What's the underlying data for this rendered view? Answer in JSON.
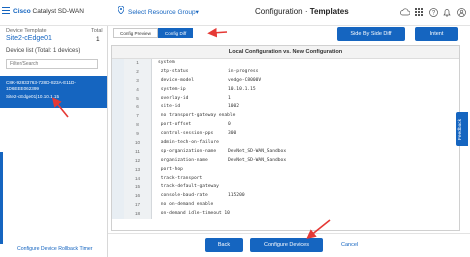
{
  "header": {
    "brand": "Cisco",
    "brand_product": "Catalyst SD-WAN",
    "resource_group": "Select Resource Group",
    "resource_chevron": "▾",
    "title_prefix": "Configuration",
    "title_separator": " · ",
    "title_main": "Templates",
    "icons": [
      "cloud-icon",
      "grid-icon",
      "help-icon",
      "bell-icon",
      "user-icon"
    ]
  },
  "sidebar": {
    "device_template_label": "Device Template",
    "device_template_value": "Site2-cEdge01",
    "total_label": "Total",
    "total_value": "1",
    "device_list_label": "Device list (Total: 1 devices)",
    "filter_placeholder": "Filter/Search",
    "device": {
      "id": "C8K-92833763-728D-823A-E11D-1D6EEE062399",
      "sub": "Site2-cEdge01|10.10.1.15"
    },
    "rollback_link": "Configure Device Rollback Timer"
  },
  "tabs": [
    {
      "label": "Config Preview",
      "active": false
    },
    {
      "label": "Config Diff",
      "active": true
    }
  ],
  "actions": {
    "side_by_side": "Side By Side Diff",
    "intent": "Intent"
  },
  "code_panel": {
    "heading": "Local Configuration vs. New Configuration",
    "lines": [
      {
        "num": "1",
        "key": "system",
        "val": ""
      },
      {
        "num": "2",
        "key": " ztp-status",
        "val": "in-progress"
      },
      {
        "num": "3",
        "key": " device-model",
        "val": "vedge-C8000V"
      },
      {
        "num": "4",
        "key": " system-ip",
        "val": "10.10.1.15"
      },
      {
        "num": "5",
        "key": " overlay-id",
        "val": "1"
      },
      {
        "num": "6",
        "key": " site-id",
        "val": "1002"
      },
      {
        "num": "7",
        "key": " no transport-gateway enable",
        "val": ""
      },
      {
        "num": "8",
        "key": " port-offset",
        "val": "0"
      },
      {
        "num": "9",
        "key": " control-session-pps",
        "val": "300"
      },
      {
        "num": "10",
        "key": " admin-tech-on-failure",
        "val": ""
      },
      {
        "num": "11",
        "key": " sp-organization-name",
        "val": "DevNet_SD-WAN_Sandbox"
      },
      {
        "num": "12",
        "key": " organization-name",
        "val": "DevNet_SD-WAN_Sandbox"
      },
      {
        "num": "13",
        "key": " port-hop",
        "val": ""
      },
      {
        "num": "14",
        "key": " track-transport",
        "val": ""
      },
      {
        "num": "15",
        "key": " track-default-gateway",
        "val": ""
      },
      {
        "num": "16",
        "key": " console-baud-rate",
        "val": "115200"
      },
      {
        "num": "17",
        "key": " no on-demand enable",
        "val": ""
      },
      {
        "num": "18",
        "key": " on-demand idle-timeout 10",
        "val": ""
      }
    ]
  },
  "feedback_label": "Feedback",
  "footer": {
    "back": "Back",
    "configure": "Configure Devices",
    "cancel": "Cancel"
  },
  "colors": {
    "accent": "#1565c0",
    "annotation": "#e53935"
  }
}
